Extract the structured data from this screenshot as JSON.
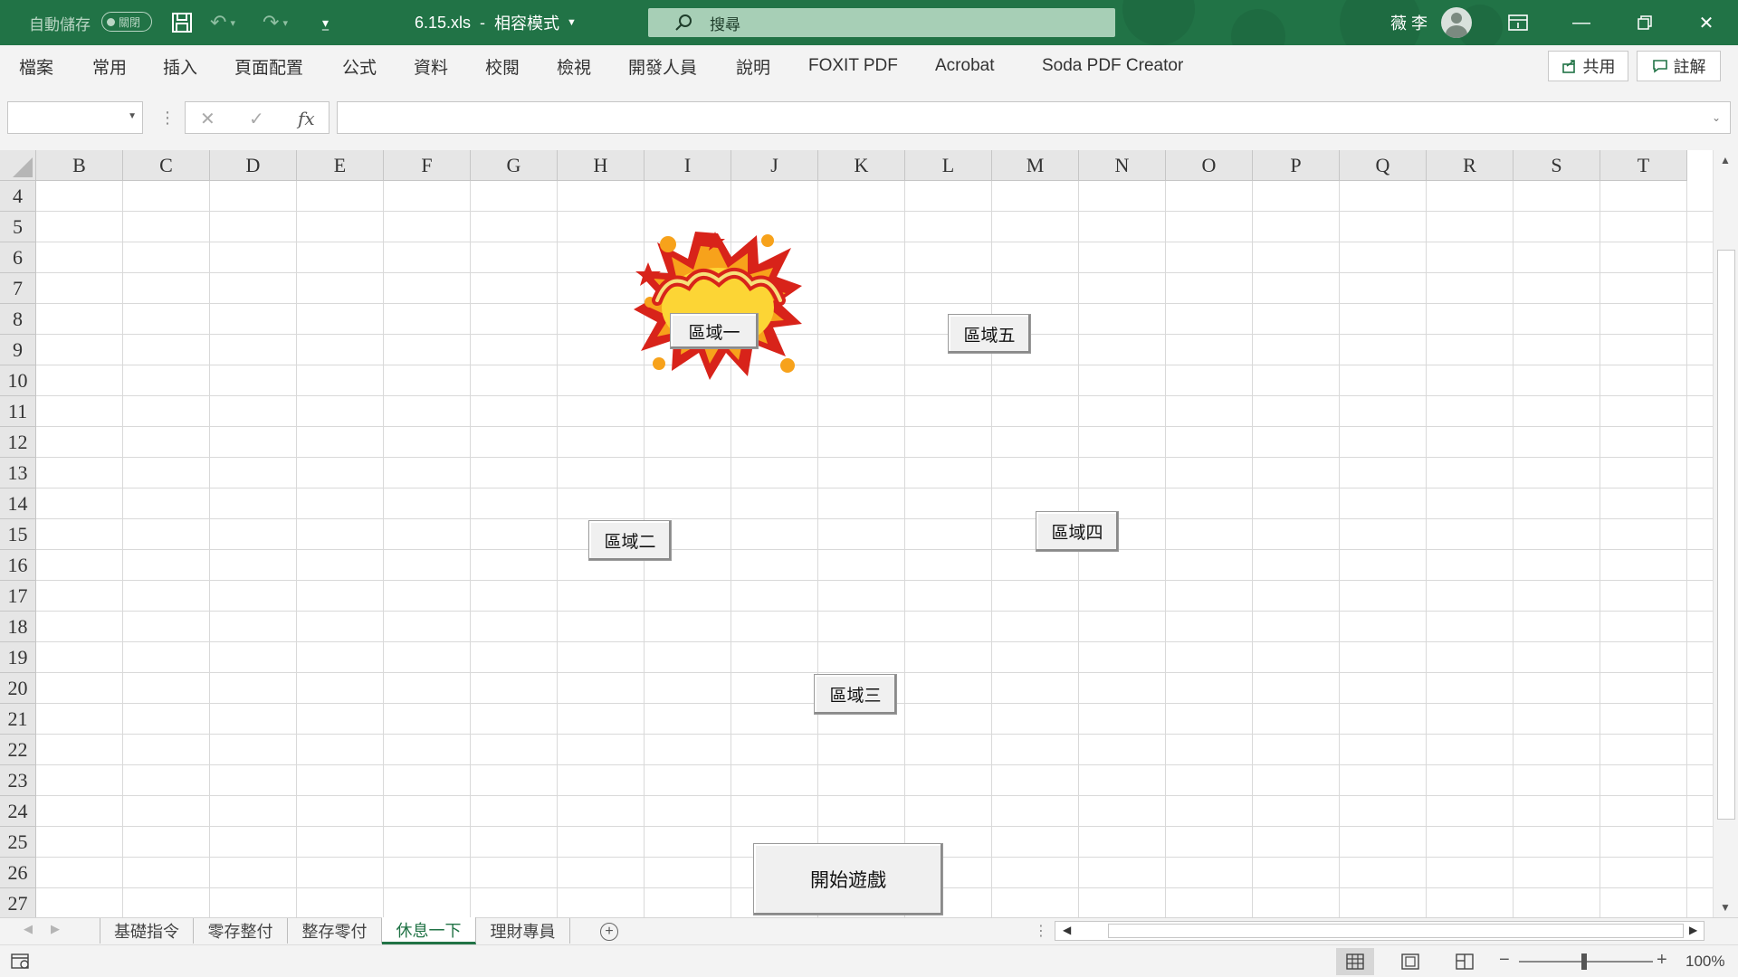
{
  "titlebar": {
    "autosave_label": "自動儲存",
    "autosave_state": "關閉",
    "filename": "6.15.xls",
    "separator": "-",
    "mode": "相容模式",
    "search_placeholder": "搜尋",
    "username": "薇 李",
    "colors": {
      "bar": "#217346"
    }
  },
  "ribbon": {
    "tabs": [
      "檔案",
      "常用",
      "插入",
      "頁面配置",
      "公式",
      "資料",
      "校閱",
      "檢視",
      "開發人員",
      "說明",
      "FOXIT PDF",
      "Acrobat",
      "Soda PDF Creator"
    ],
    "share_label": "共用",
    "comment_label": "註解"
  },
  "formula_bar": {
    "name_box": "",
    "formula": "",
    "fx_label": "fx"
  },
  "grid": {
    "columns": [
      "B",
      "C",
      "D",
      "E",
      "F",
      "G",
      "H",
      "I",
      "J",
      "K",
      "L",
      "M",
      "N",
      "O",
      "P",
      "Q",
      "R",
      "S",
      "T"
    ],
    "rows": [
      "4",
      "5",
      "6",
      "7",
      "8",
      "9",
      "10",
      "11",
      "12",
      "13",
      "14",
      "15",
      "16",
      "17",
      "18",
      "19",
      "20",
      "21",
      "22",
      "23",
      "24",
      "25",
      "26",
      "27"
    ]
  },
  "sheet_buttons": {
    "region1": "區域一",
    "region2": "區域二",
    "region3": "區域三",
    "region4": "區域四",
    "region5": "區域五",
    "start": "開始遊戲"
  },
  "sheet_tabs": {
    "tabs": [
      "基礎指令",
      "零存整付",
      "整存零付",
      "休息一下",
      "理財專員"
    ],
    "active": "休息一下"
  },
  "statusbar": {
    "zoom": "100%"
  }
}
